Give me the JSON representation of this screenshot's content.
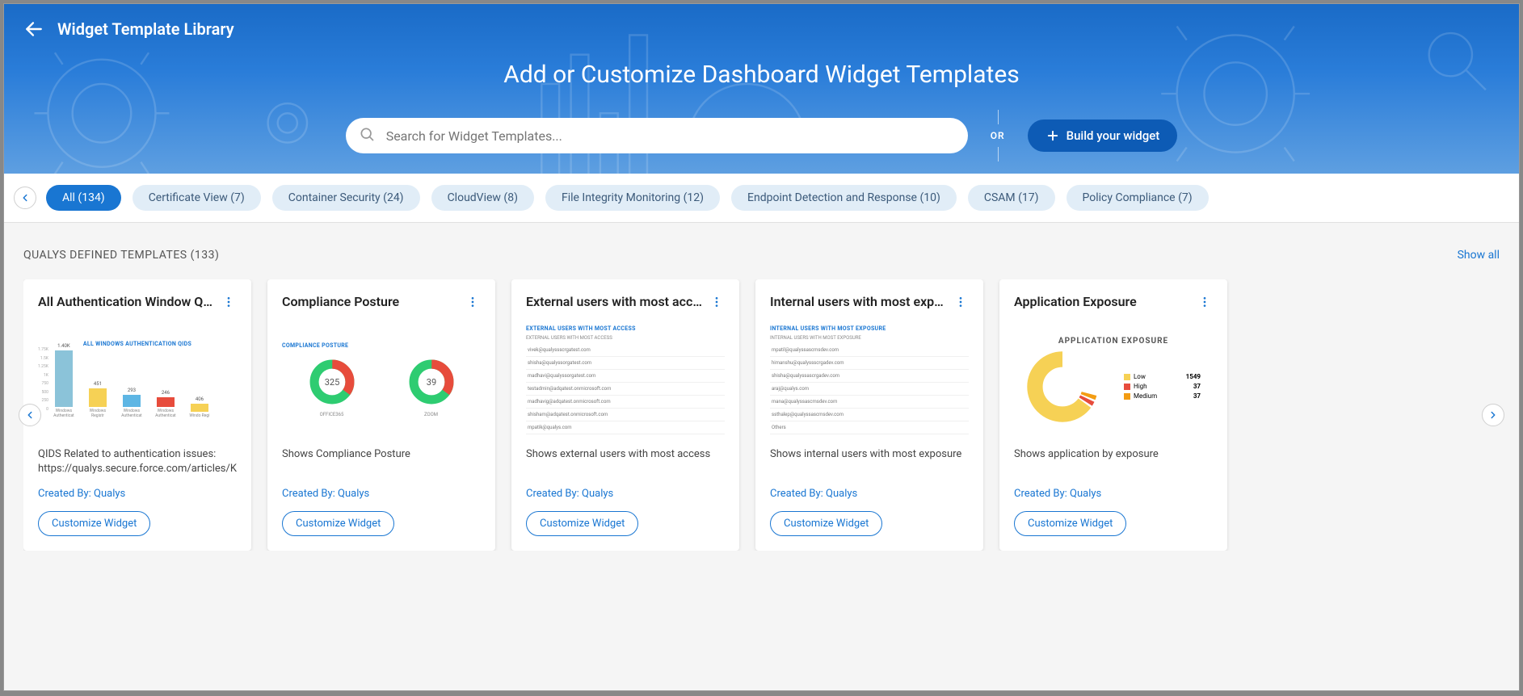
{
  "header": {
    "label": "Widget Template Library",
    "title": "Add or Customize Dashboard Widget Templates",
    "search_placeholder": "Search for Widget Templates...",
    "or": "OR",
    "build_button": "Build your widget"
  },
  "filters": [
    {
      "label": "All (134)",
      "active": true
    },
    {
      "label": "Certificate View (7)",
      "active": false
    },
    {
      "label": "Container Security (24)",
      "active": false
    },
    {
      "label": "CloudView (8)",
      "active": false
    },
    {
      "label": "File Integrity Monitoring (12)",
      "active": false
    },
    {
      "label": "Endpoint Detection and Response (10)",
      "active": false
    },
    {
      "label": "CSAM (17)",
      "active": false
    },
    {
      "label": "Policy Compliance (7)",
      "active": false
    }
  ],
  "section": {
    "title": "QUALYS DEFINED TEMPLATES (133)",
    "show_all": "Show all"
  },
  "customize_label": "Customize Widget",
  "cards": [
    {
      "title": "All Authentication Window QI…",
      "desc": "QIDS Related to authentication issues: https://qualys.secure.force.com/articles/Knowled",
      "creator": "Created By: Qualys",
      "preview_title": "ALL WINDOWS AUTHENTICATION QIDS",
      "bars": [
        {
          "v": 1400,
          "label": "Windows Authenticat",
          "display": "1.40K",
          "color": "#8bc3d9"
        },
        {
          "v": 451,
          "label": "Windows Registr",
          "display": "451",
          "color": "#f6d155"
        },
        {
          "v": 293,
          "label": "Windows Authenticat",
          "display": "293",
          "color": "#5eb6e4"
        },
        {
          "v": 246,
          "label": "Windows Authenticat",
          "display": "246",
          "color": "#e74c3c"
        },
        {
          "v": 200,
          "label": "Windo Regi",
          "display": "406",
          "color": "#f6d155"
        }
      ],
      "yaxis": [
        "1.75K",
        "1.5K",
        "1.25K",
        "1K",
        "750",
        "500",
        "250",
        "0"
      ]
    },
    {
      "title": "Compliance Posture",
      "desc": "Shows Compliance Posture",
      "creator": "Created By: Qualys",
      "preview_title": "COMPLIANCE POSTURE",
      "donuts": [
        {
          "value": "325",
          "label": "OFFICE365"
        },
        {
          "value": "39",
          "label": "ZOOM"
        }
      ]
    },
    {
      "title": "External users with most acc…",
      "desc": "Shows external users with most access",
      "creator": "Created By: Qualys",
      "preview_title": "EXTERNAL USERS WITH MOST ACCESS",
      "preview_sub": "EXTERNAL USERS WITH MOST ACCESS",
      "rows": [
        "vivek@qualyssscrgatest.com",
        "shisha@qualyssorgatest.com",
        "madhavi@qualyssorgatest.com",
        "testadmin@adqatest.onmicrosoft.com",
        "madhavig@adqatest.onmicrosoft.com",
        "shisham@adqatest.onmicrosoft.com",
        "mpatik@qualys.com"
      ]
    },
    {
      "title": "Internal users with most expo…",
      "desc": "Shows internal users with most exposure",
      "creator": "Created By: Qualys",
      "preview_title": "INTERNAL USERS WITH MOST EXPOSURE",
      "preview_sub": "INTERNAL USERS WITH MOST EXPOSURE",
      "rows": [
        "mpatil@qualyssascmsdev.com",
        "himanshu@qualyssscrgadev.com",
        "shisha@qualyssascrgadev.com",
        "araj@qualys.com",
        "mana@qualyssascmsdev.com",
        "ssthalep@qualyssascmsdev.com",
        "Others"
      ]
    },
    {
      "title": "Application Exposure",
      "desc": "Shows application by exposure",
      "creator": "Created By: Qualys",
      "preview_title": "APPLICATION EXPOSURE",
      "legend": [
        {
          "label": "Low",
          "value": "1549",
          "color": "#f6d155"
        },
        {
          "label": "High",
          "value": "37",
          "color": "#e74c3c"
        },
        {
          "label": "Medium",
          "value": "37",
          "color": "#f39c12"
        }
      ]
    }
  ]
}
